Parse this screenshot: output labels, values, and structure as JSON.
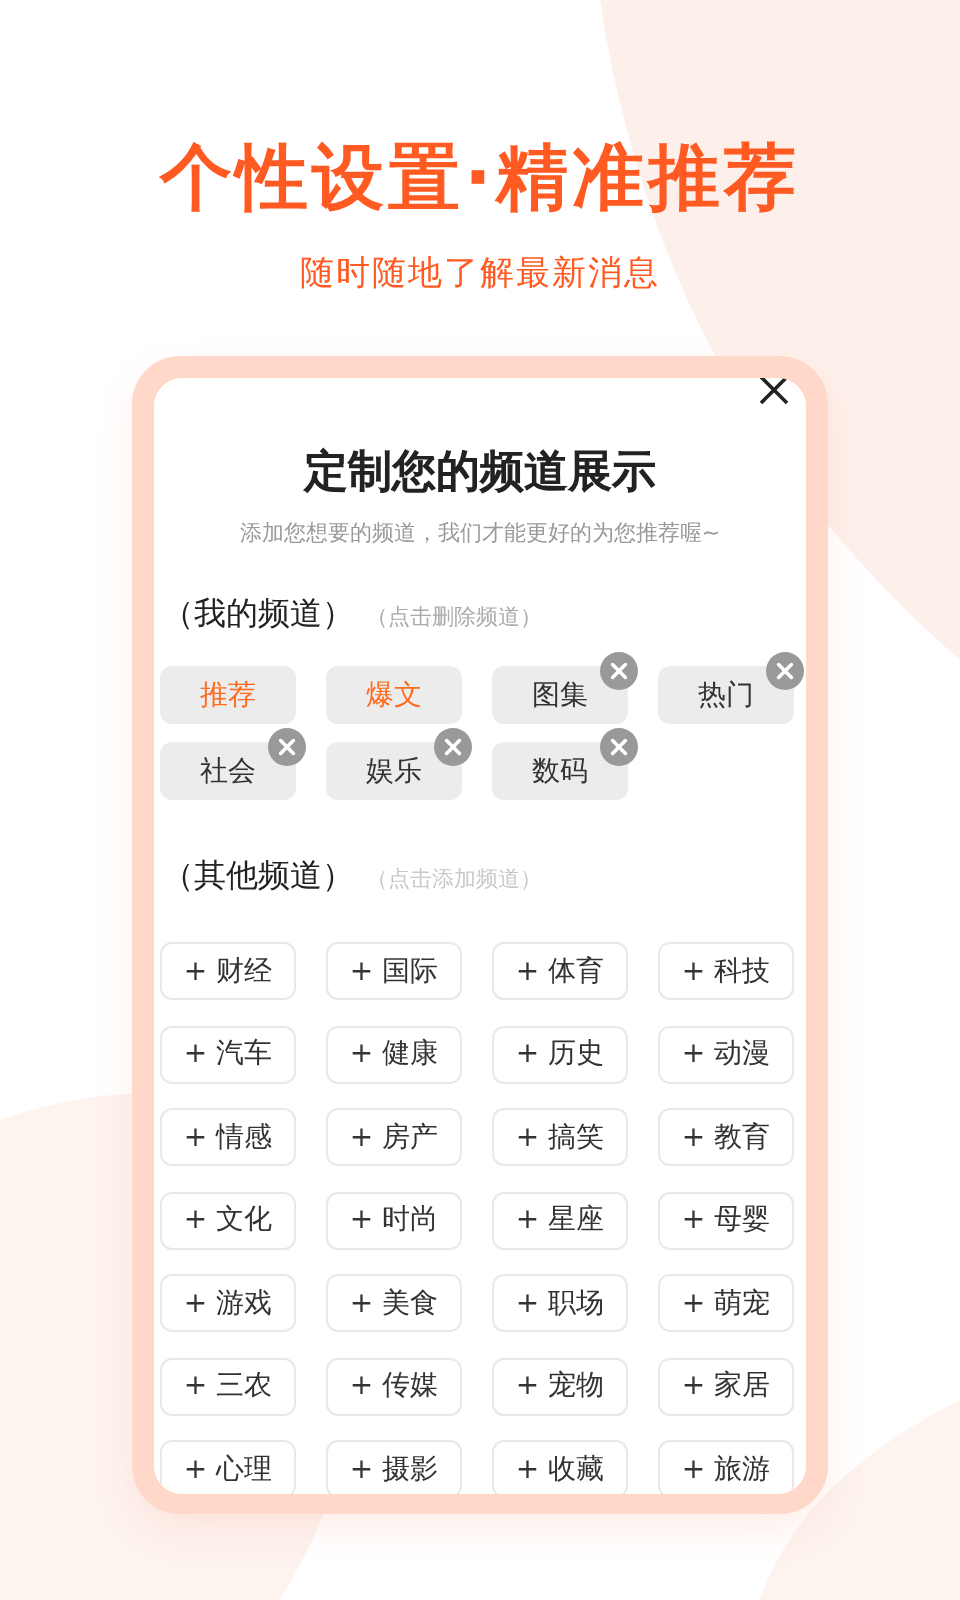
{
  "headline": "个性设置·精准推荐",
  "tagline": "随时随地了解最新消息",
  "dialog": {
    "title": "定制您的频道展示",
    "subtitle": "添加您想要的频道，我们才能更好的为您推荐喔~",
    "my_channels": {
      "heading": "（我的频道）",
      "hint": "（点击删除频道）",
      "items": [
        {
          "label": "推荐",
          "kind": "fixed"
        },
        {
          "label": "爆文",
          "kind": "fixed"
        },
        {
          "label": "图集",
          "kind": "removable"
        },
        {
          "label": "热门",
          "kind": "removable"
        },
        {
          "label": "社会",
          "kind": "removable"
        },
        {
          "label": "娱乐",
          "kind": "removable"
        },
        {
          "label": "数码",
          "kind": "removable"
        }
      ]
    },
    "other_channels": {
      "heading": "（其他频道）",
      "hint": "（点击添加频道）",
      "items": [
        "+ 财经",
        "+ 国际",
        "+ 体育",
        "+ 科技",
        "+ 汽车",
        "+ 健康",
        "+ 历史",
        "+ 动漫",
        "+ 情感",
        "+ 房产",
        "+ 搞笑",
        "+ 教育",
        "+ 文化",
        "+ 时尚",
        "+ 星座",
        "+ 母婴",
        "+ 游戏",
        "+ 美食",
        "+ 职场",
        "+ 萌宠",
        "+ 三农",
        "+ 传媒",
        "+ 宠物",
        "+ 家居",
        "+ 心理",
        "+ 摄影",
        "+ 收藏",
        "+ 旅游"
      ]
    }
  }
}
